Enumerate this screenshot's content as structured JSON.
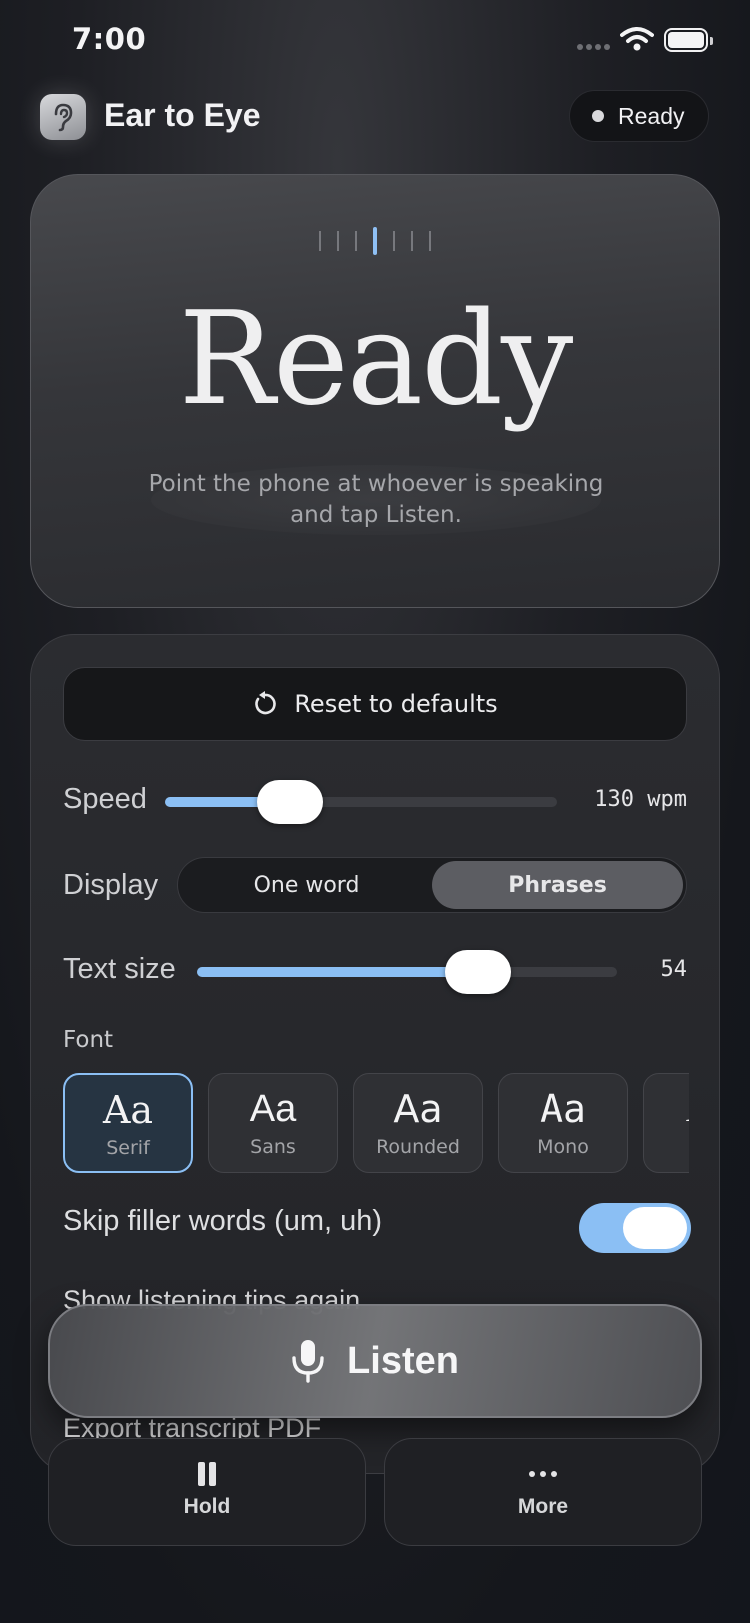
{
  "status_bar": {
    "time": "7:00"
  },
  "header": {
    "title": "Ear to Eye",
    "status": "Ready"
  },
  "reader": {
    "word": "Ready",
    "hint": "Point the phone at whoever is speaking and tap Listen."
  },
  "settings": {
    "reset_label": "Reset to defaults",
    "speed": {
      "label": "Speed",
      "value_text": "130 wpm",
      "level": 0.32
    },
    "display": {
      "label": "Display",
      "options": [
        "One word",
        "Phrases"
      ],
      "selected": "Phrases"
    },
    "text_size": {
      "label": "Text size",
      "value_text": "54",
      "level": 0.67
    },
    "font": {
      "label": "Font",
      "sample": "Aa",
      "options": [
        "Serif",
        "Sans",
        "Rounded",
        "Mono",
        "Ge"
      ],
      "selected": "Serif"
    },
    "skip_filler": {
      "label": "Skip filler words (um, uh)",
      "on": true
    },
    "rows": [
      "Show listening tips again",
      "Export transcript PDF"
    ]
  },
  "actions": {
    "listen": "Listen",
    "hold": "Hold",
    "more": "More"
  },
  "colors": {
    "accent": "#8bbff4",
    "background": "#1b1c21",
    "card": "#2b2c30"
  }
}
